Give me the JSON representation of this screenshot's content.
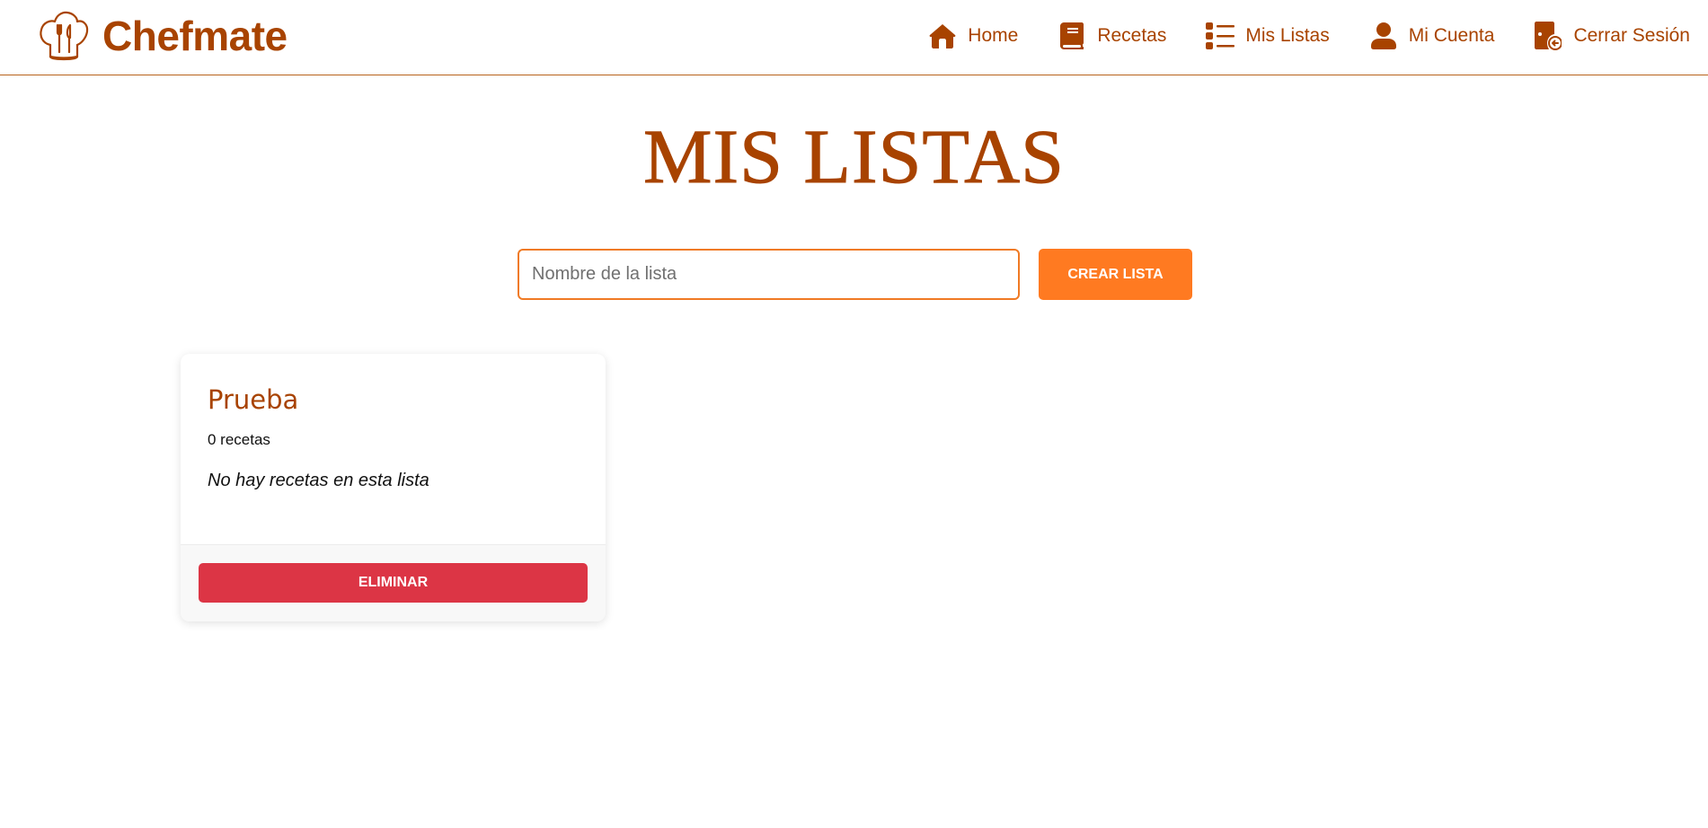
{
  "brand": {
    "name": "Chefmate",
    "logo_icon": "chef-hat-fork-knife-icon",
    "color": "#a84300"
  },
  "nav": {
    "items": [
      {
        "label": "Home",
        "icon": "home-icon"
      },
      {
        "label": "Recetas",
        "icon": "book-icon"
      },
      {
        "label": "Mis Listas",
        "icon": "list-icon"
      },
      {
        "label": "Mi Cuenta",
        "icon": "user-icon"
      },
      {
        "label": "Cerrar Sesión",
        "icon": "logout-icon"
      }
    ]
  },
  "main": {
    "title": "MIS LISTAS",
    "create": {
      "placeholder": "Nombre de la lista",
      "value": "",
      "button_label": "CREAR LISTA",
      "accent_color": "#ff7a21"
    },
    "lists": [
      {
        "name": "Prueba",
        "count_text": "0 recetas",
        "empty_text": "No hay recetas en esta lista",
        "delete_label": "ELIMINAR",
        "delete_color": "#dc3545"
      }
    ]
  }
}
